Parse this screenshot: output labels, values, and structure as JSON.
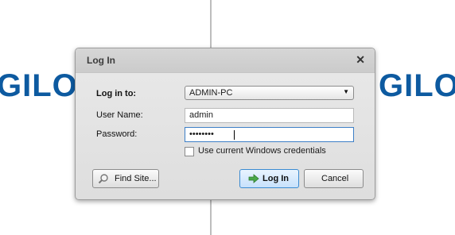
{
  "background": {
    "brand_text_left": "GILO",
    "brand_text_right": "GILO",
    "brand_color": "#0d5aa0"
  },
  "dialog": {
    "title": "Log In",
    "close_icon": "close-icon",
    "login_to_label": "Log in to:",
    "login_to_value": "ADMIN-PC",
    "username_label": "User Name:",
    "username_value": "admin",
    "password_label": "Password:",
    "password_value": "••••••••",
    "use_windows_credentials_label": "Use current Windows credentials",
    "use_windows_credentials_checked": false,
    "find_site_label": "Find Site...",
    "login_button_label": "Log In",
    "cancel_button_label": "Cancel",
    "accent": "#3b8bd1"
  }
}
